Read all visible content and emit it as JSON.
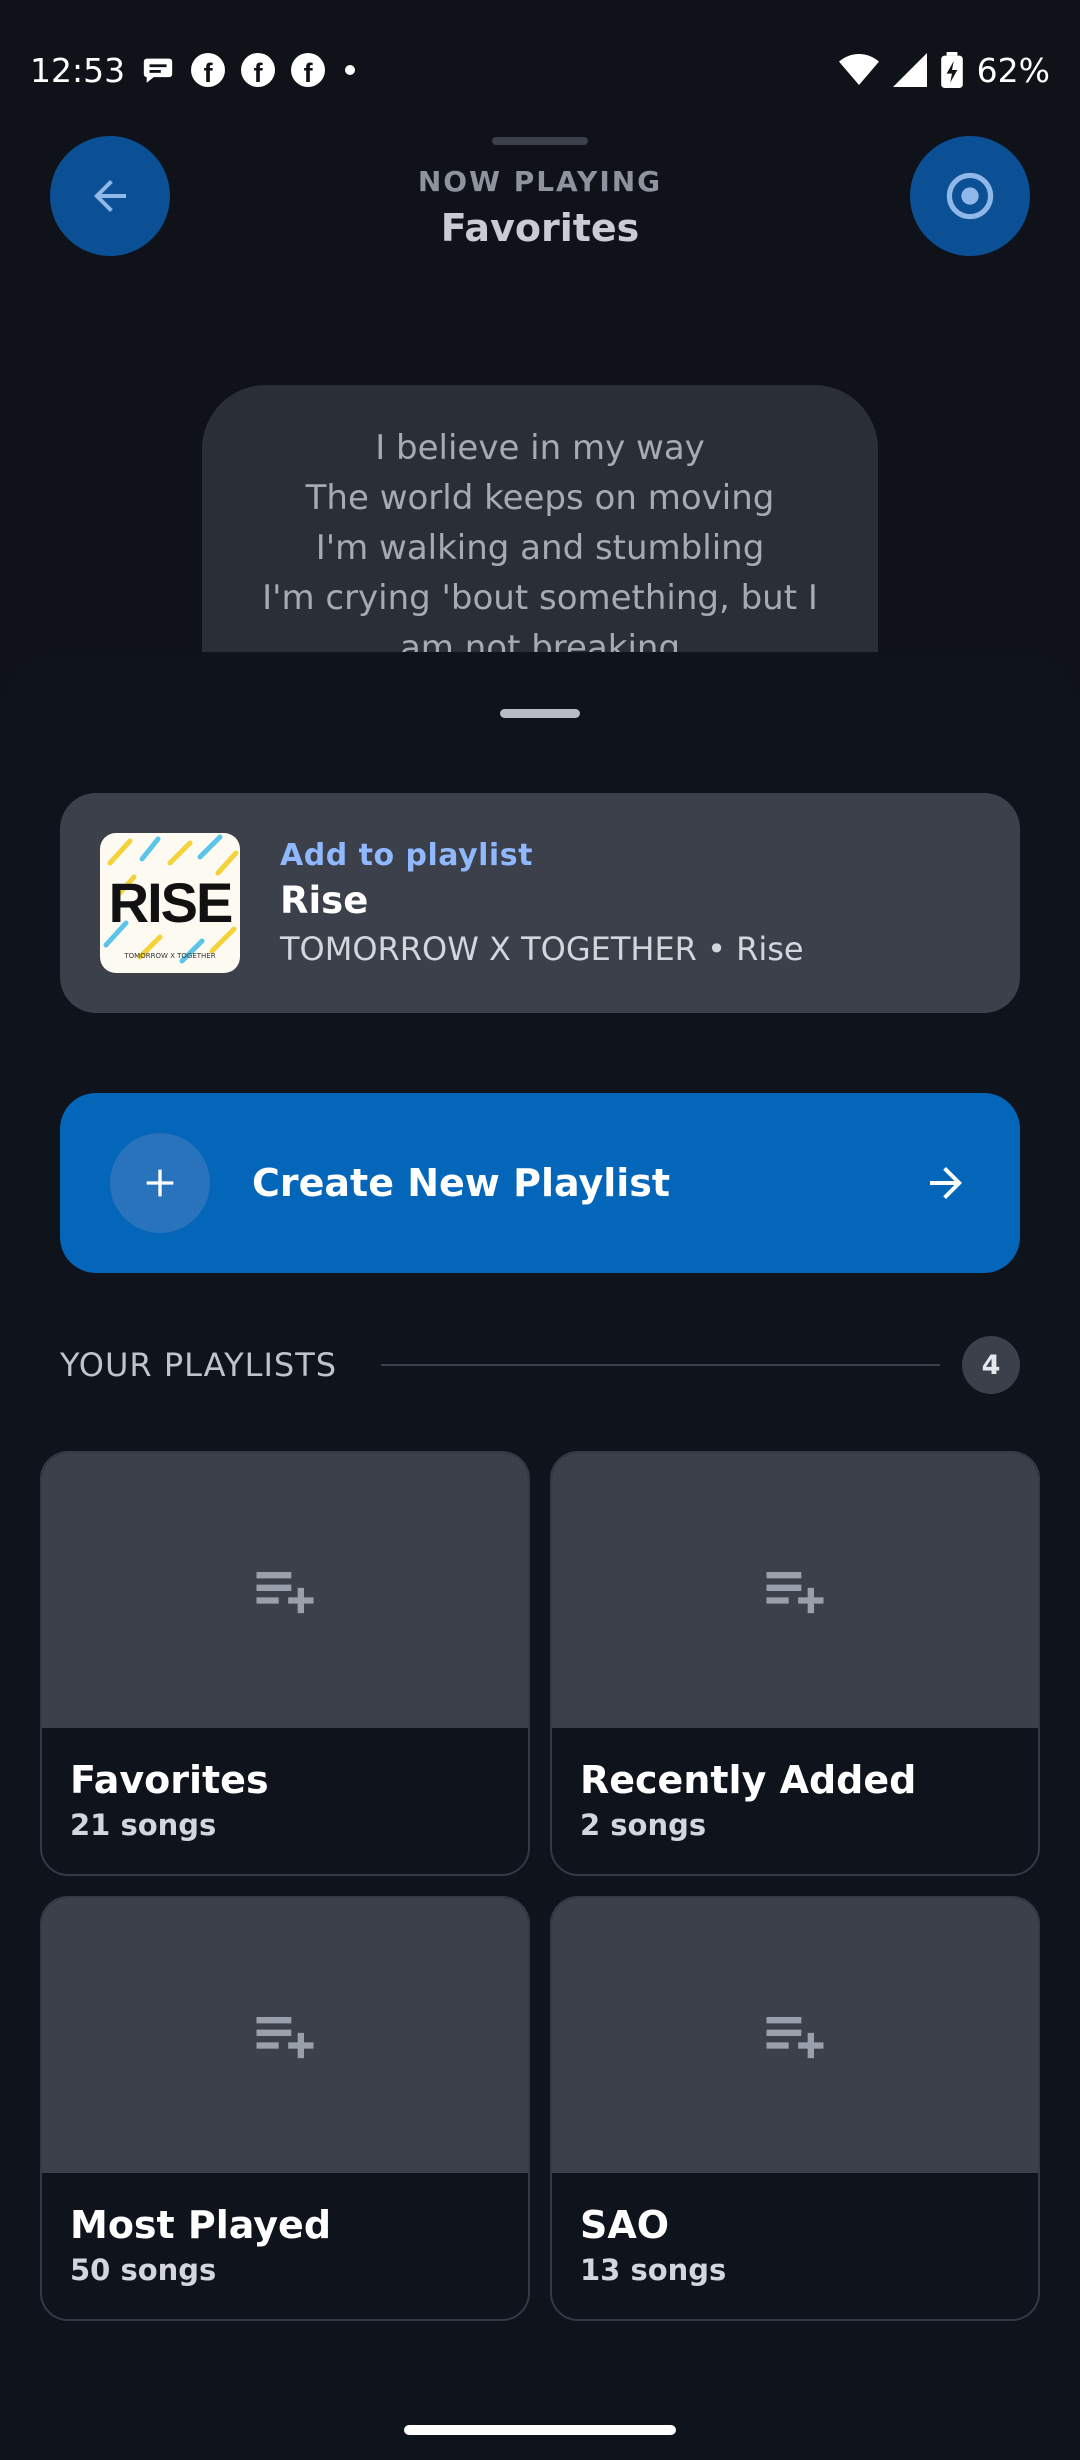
{
  "status_bar": {
    "time": "12:53",
    "battery_percent": "62%",
    "notification_icons": [
      "chat-bubble-icon",
      "facebook-icon",
      "facebook-icon",
      "facebook-icon"
    ],
    "facebook_glyph": "f",
    "system_icons": [
      "wifi-icon",
      "cell-signal-icon",
      "battery-charging-icon"
    ]
  },
  "header": {
    "label": "NOW PLAYING",
    "title": "Favorites",
    "left_button_icon": "back-arrow-icon",
    "right_button_icon": "target-icon"
  },
  "lyrics": {
    "lines": [
      "I believe in my way",
      "The world keeps on moving",
      "I'm walking and stumbling",
      "I'm crying 'bout something, but I",
      "am not breaking"
    ]
  },
  "sheet": {
    "song": {
      "kicker": "Add to playlist",
      "title": "Rise",
      "subtitle": "TOMORROW X TOGETHER • Rise",
      "art_text": "RISE",
      "art_subtext": "TOMORROW X TOGETHER"
    },
    "create_button": {
      "label": "Create New Playlist"
    },
    "section": {
      "title": "YOUR PLAYLISTS",
      "count": "4"
    },
    "playlists": [
      {
        "name": "Favorites",
        "count": "21 songs"
      },
      {
        "name": "Recently Added",
        "count": "2 songs"
      },
      {
        "name": "Most Played",
        "count": "50 songs"
      },
      {
        "name": "SAO",
        "count": "13 songs"
      }
    ]
  },
  "colors": {
    "background": "#0f1219",
    "accent": "#0366b8",
    "card": "#3c404b",
    "link": "#8fb8ff"
  }
}
